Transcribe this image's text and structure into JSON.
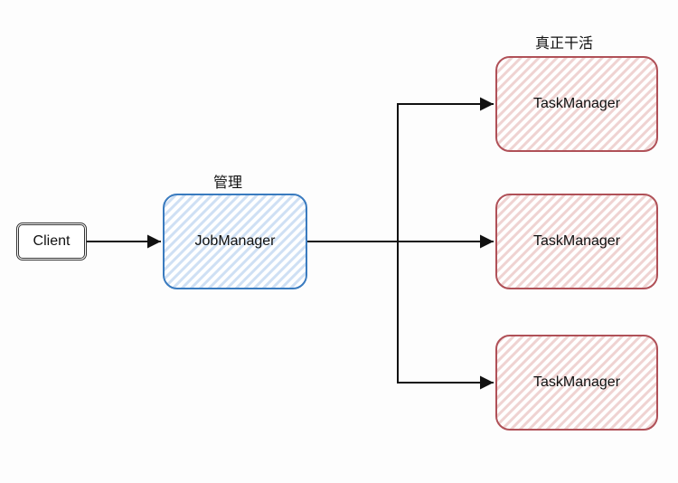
{
  "labels": {
    "jobmgr_annot": "管理",
    "taskmgr_annot": "真正干活"
  },
  "nodes": {
    "client": "Client",
    "jobmgr": "JobManager",
    "task1": "TaskManager",
    "task2": "TaskManager",
    "task3": "TaskManager"
  },
  "colors": {
    "jobmgr_border": "#3a7bbf",
    "jobmgr_fill": "#dfe9f7",
    "task_border": "#b05158",
    "task_fill": "#f4e0df",
    "arrow": "#111"
  }
}
